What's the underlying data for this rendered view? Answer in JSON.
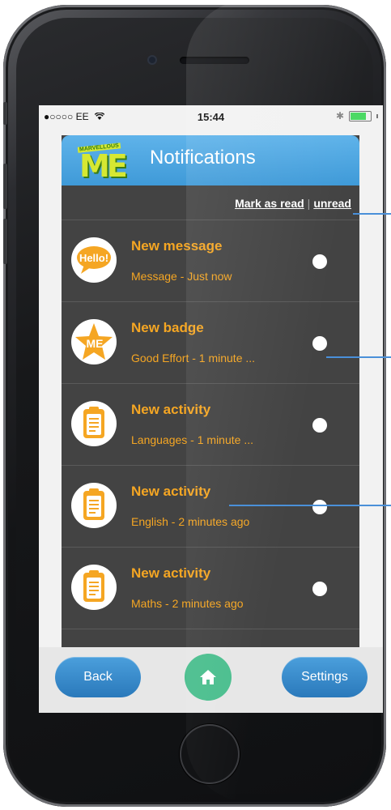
{
  "status_bar": {
    "carrier": "●○○○○ EE",
    "wifi_icon": "wifi-icon",
    "time": "15:44",
    "bluetooth_icon": "bluetooth-icon",
    "battery_icon": "battery-icon",
    "battery_level": 0.75
  },
  "header": {
    "logo_top": "MARVELLOUS",
    "logo_main": "ME",
    "title": "Notifications",
    "color": "#4aa3e0"
  },
  "mark_bar": {
    "mark_as_read": "Mark as read",
    "separator": "|",
    "unread": "unread"
  },
  "notifications": [
    {
      "icon": "hello-speech-icon",
      "icon_text": "Hello!",
      "title": "New message",
      "subtitle": "Message - Just now"
    },
    {
      "icon": "badge-star-icon",
      "icon_text": "ME",
      "title": "New badge",
      "subtitle": "Good Effort - 1 minute ..."
    },
    {
      "icon": "clipboard-icon",
      "title": "New activity",
      "subtitle": "Languages - 1 minute ..."
    },
    {
      "icon": "clipboard-icon",
      "title": "New activity",
      "subtitle": "English - 2 minutes ago"
    },
    {
      "icon": "clipboard-icon",
      "title": "New activity",
      "subtitle": "Maths - 2 minutes ago"
    }
  ],
  "bottom_bar": {
    "back_label": "Back",
    "home_icon": "home-icon",
    "settings_label": "Settings"
  },
  "colors": {
    "accent_orange": "#f5a623",
    "list_background": "#434343",
    "button_blue": "#3a8ccc",
    "home_green": "#4cbf8f"
  }
}
